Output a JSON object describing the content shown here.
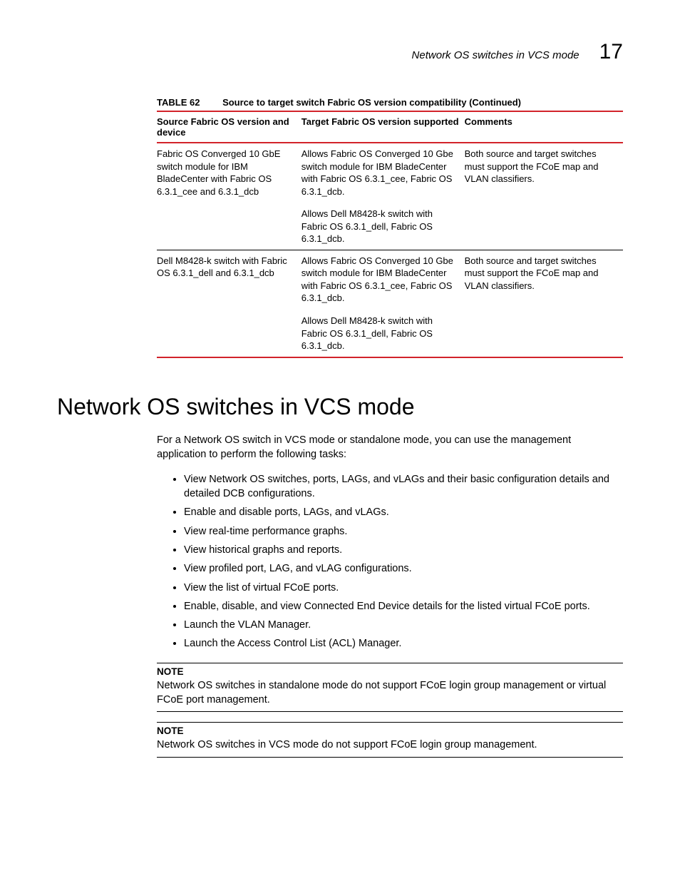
{
  "header": {
    "title": "Network OS switches in VCS mode",
    "chapter_number": "17"
  },
  "table": {
    "label": "TABLE 62",
    "caption": "Source to target switch Fabric OS version compatibility (Continued)",
    "columns": [
      "Source Fabric OS version and device",
      "Target Fabric OS version supported",
      "Comments"
    ],
    "rows": [
      {
        "source": "Fabric OS Converged 10 GbE switch module for IBM BladeCenter with Fabric OS 6.3.1_cee and 6.3.1_dcb",
        "target_p1": "Allows Fabric OS Converged 10 Gbe switch module for IBM BladeCenter with Fabric OS 6.3.1_cee, Fabric OS 6.3.1_dcb.",
        "target_p2": "Allows Dell M8428-k switch with Fabric OS 6.3.1_dell, Fabric OS 6.3.1_dcb.",
        "comments": "Both source and target switches must support the FCoE map and VLAN classifiers."
      },
      {
        "source": "Dell M8428-k switch with Fabric OS 6.3.1_dell and 6.3.1_dcb",
        "target_p1": "Allows Fabric OS Converged 10 Gbe switch module for IBM BladeCenter with Fabric OS 6.3.1_cee, Fabric OS 6.3.1_dcb.",
        "target_p2": "Allows Dell M8428-k switch with Fabric OS 6.3.1_dell, Fabric OS 6.3.1_dcb.",
        "comments": "Both source and target switches must support the FCoE map and VLAN classifiers."
      }
    ]
  },
  "section": {
    "heading": "Network OS switches in VCS mode",
    "intro": "For a Network OS switch in VCS mode or standalone mode, you can use the management application to perform the following tasks:",
    "tasks": [
      "View Network OS switches, ports, LAGs, and vLAGs and their basic configuration details and detailed DCB configurations.",
      "Enable and disable ports, LAGs, and vLAGs.",
      "View real-time performance graphs.",
      "View historical graphs and reports.",
      "View profiled port, LAG, and vLAG configurations.",
      "View the list of virtual FCoE ports.",
      "Enable, disable, and view Connected End Device details for the listed virtual FCoE ports.",
      "Launch the VLAN Manager.",
      "Launch the Access Control List (ACL) Manager."
    ],
    "notes": [
      {
        "label": "NOTE",
        "body": "Network OS switches in standalone mode do not support FCoE login group management or virtual FCoE port management."
      },
      {
        "label": "NOTE",
        "body": "Network OS switches in VCS mode do not support FCoE login group management."
      }
    ]
  }
}
